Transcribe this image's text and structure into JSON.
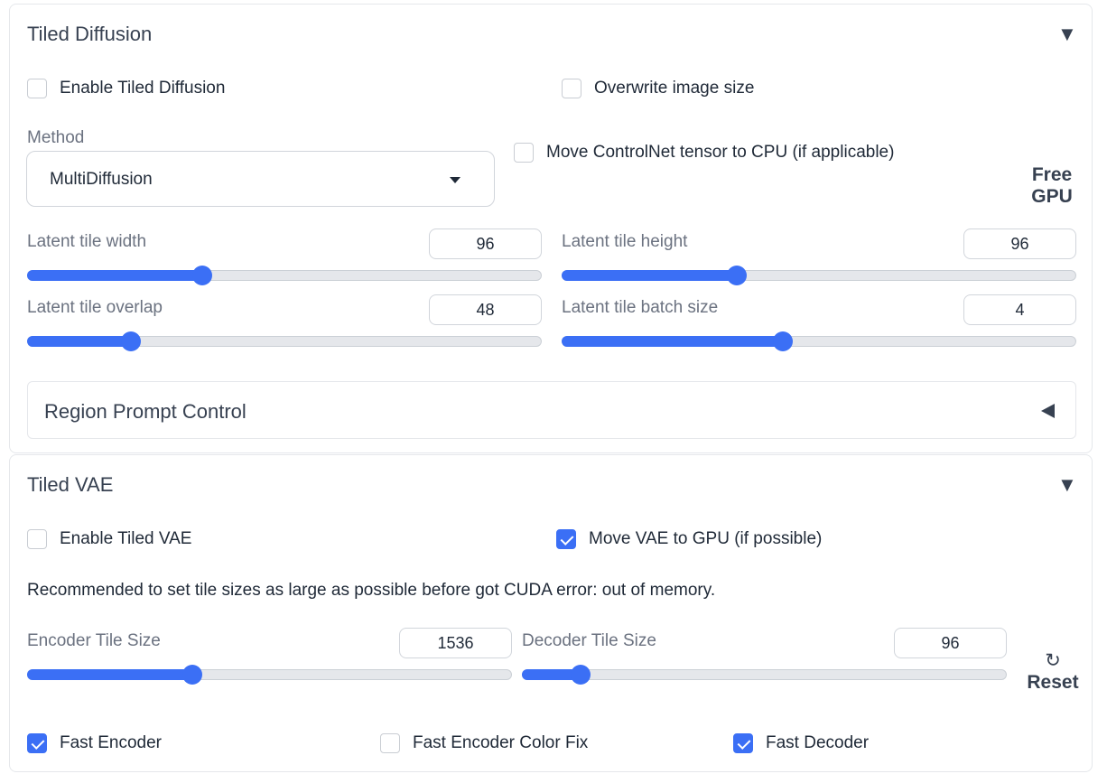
{
  "tiled_diffusion": {
    "title": "Tiled Diffusion",
    "collapse_icon": "triangle-down-icon",
    "enable_label": "Enable Tiled Diffusion",
    "enable_checked": false,
    "overwrite_label": "Overwrite image size",
    "overwrite_checked": false,
    "method_label": "Method",
    "method_value": "MultiDiffusion",
    "move_controlnet_label": "Move ControlNet tensor to CPU (if applicable)",
    "move_controlnet_checked": false,
    "free_gpu_line1": "Free",
    "free_gpu_line2": "GPU",
    "sliders": {
      "tile_width": {
        "label": "Latent tile width",
        "value": "96",
        "fraction": 0.34
      },
      "tile_height": {
        "label": "Latent tile height",
        "value": "96",
        "fraction": 0.34
      },
      "tile_overlap": {
        "label": "Latent tile overlap",
        "value": "48",
        "fraction": 0.2
      },
      "batch_size": {
        "label": "Latent tile batch size",
        "value": "4",
        "fraction": 0.43
      }
    },
    "region_prompt": {
      "title": "Region Prompt Control",
      "expand_icon": "triangle-left-icon"
    }
  },
  "tiled_vae": {
    "title": "Tiled VAE",
    "collapse_icon": "triangle-down-icon",
    "enable_label": "Enable Tiled VAE",
    "enable_checked": false,
    "move_vae_label": "Move VAE to GPU (if possible)",
    "move_vae_checked": true,
    "recommendation": "Recommended to set tile sizes as large as possible before got CUDA error: out of memory.",
    "encoder": {
      "label": "Encoder Tile Size",
      "value": "1536",
      "fraction": 0.34
    },
    "decoder": {
      "label": "Decoder Tile Size",
      "value": "96",
      "fraction": 0.12
    },
    "reset_icon": "↻",
    "reset_label": "Reset",
    "fast_encoder": {
      "label": "Fast Encoder",
      "checked": true
    },
    "fast_encoder_color_fix": {
      "label": "Fast Encoder Color Fix",
      "checked": false
    },
    "fast_decoder": {
      "label": "Fast Decoder",
      "checked": true
    }
  },
  "colors": {
    "accent": "#3b6ff5",
    "track": "#e5e7eb",
    "border": "#e5e7eb",
    "muted_text": "#6b7280"
  }
}
